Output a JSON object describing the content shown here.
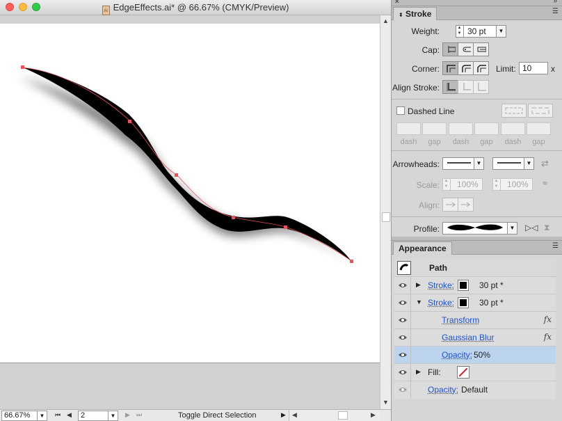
{
  "document": {
    "title": "EdgeEffects.ai* @ 66.67% (CMYK/Preview)",
    "file_icon": "Ai"
  },
  "status": {
    "zoom": "66.67%",
    "page": "2",
    "text": "Toggle Direct Selection"
  },
  "stroke_panel": {
    "tab": "Stroke",
    "weight_label": "Weight:",
    "weight_value": "30 pt",
    "cap_label": "Cap:",
    "corner_label": "Corner:",
    "limit_label": "Limit:",
    "limit_value": "10",
    "limit_unit": "x",
    "align_label": "Align Stroke:",
    "dashed_label": "Dashed Line",
    "dash_labels": [
      "dash",
      "gap",
      "dash",
      "gap",
      "dash",
      "gap"
    ],
    "arrowheads_label": "Arrowheads:",
    "scale_label": "Scale:",
    "scale_start": "100%",
    "scale_end": "100%",
    "align_arrow_label": "Align:",
    "profile_label": "Profile:"
  },
  "appearance_panel": {
    "tab": "Appearance",
    "header": "Path",
    "rows": [
      {
        "label": "Stroke:",
        "value": "30 pt *"
      },
      {
        "label": "Stroke:",
        "value": "30 pt *"
      },
      {
        "label": "Transform"
      },
      {
        "label": "Gaussian Blur"
      },
      {
        "label": "Opacity:",
        "value": "50%"
      },
      {
        "label": "Fill:"
      },
      {
        "label": "Opacity:",
        "value": "Default"
      }
    ]
  },
  "colors": {
    "anchor": "#e8545a",
    "path_stroke": "#000000",
    "selection_row": "#bcd4f0",
    "link": "#1f53c1"
  },
  "icons": [
    "close-icon",
    "eye-icon",
    "fx-icon",
    "expand-triangle-icon",
    "collapse-triangle-icon",
    "dropdown-arrow-icon",
    "swap-arrows-icon",
    "flip-icon"
  ]
}
